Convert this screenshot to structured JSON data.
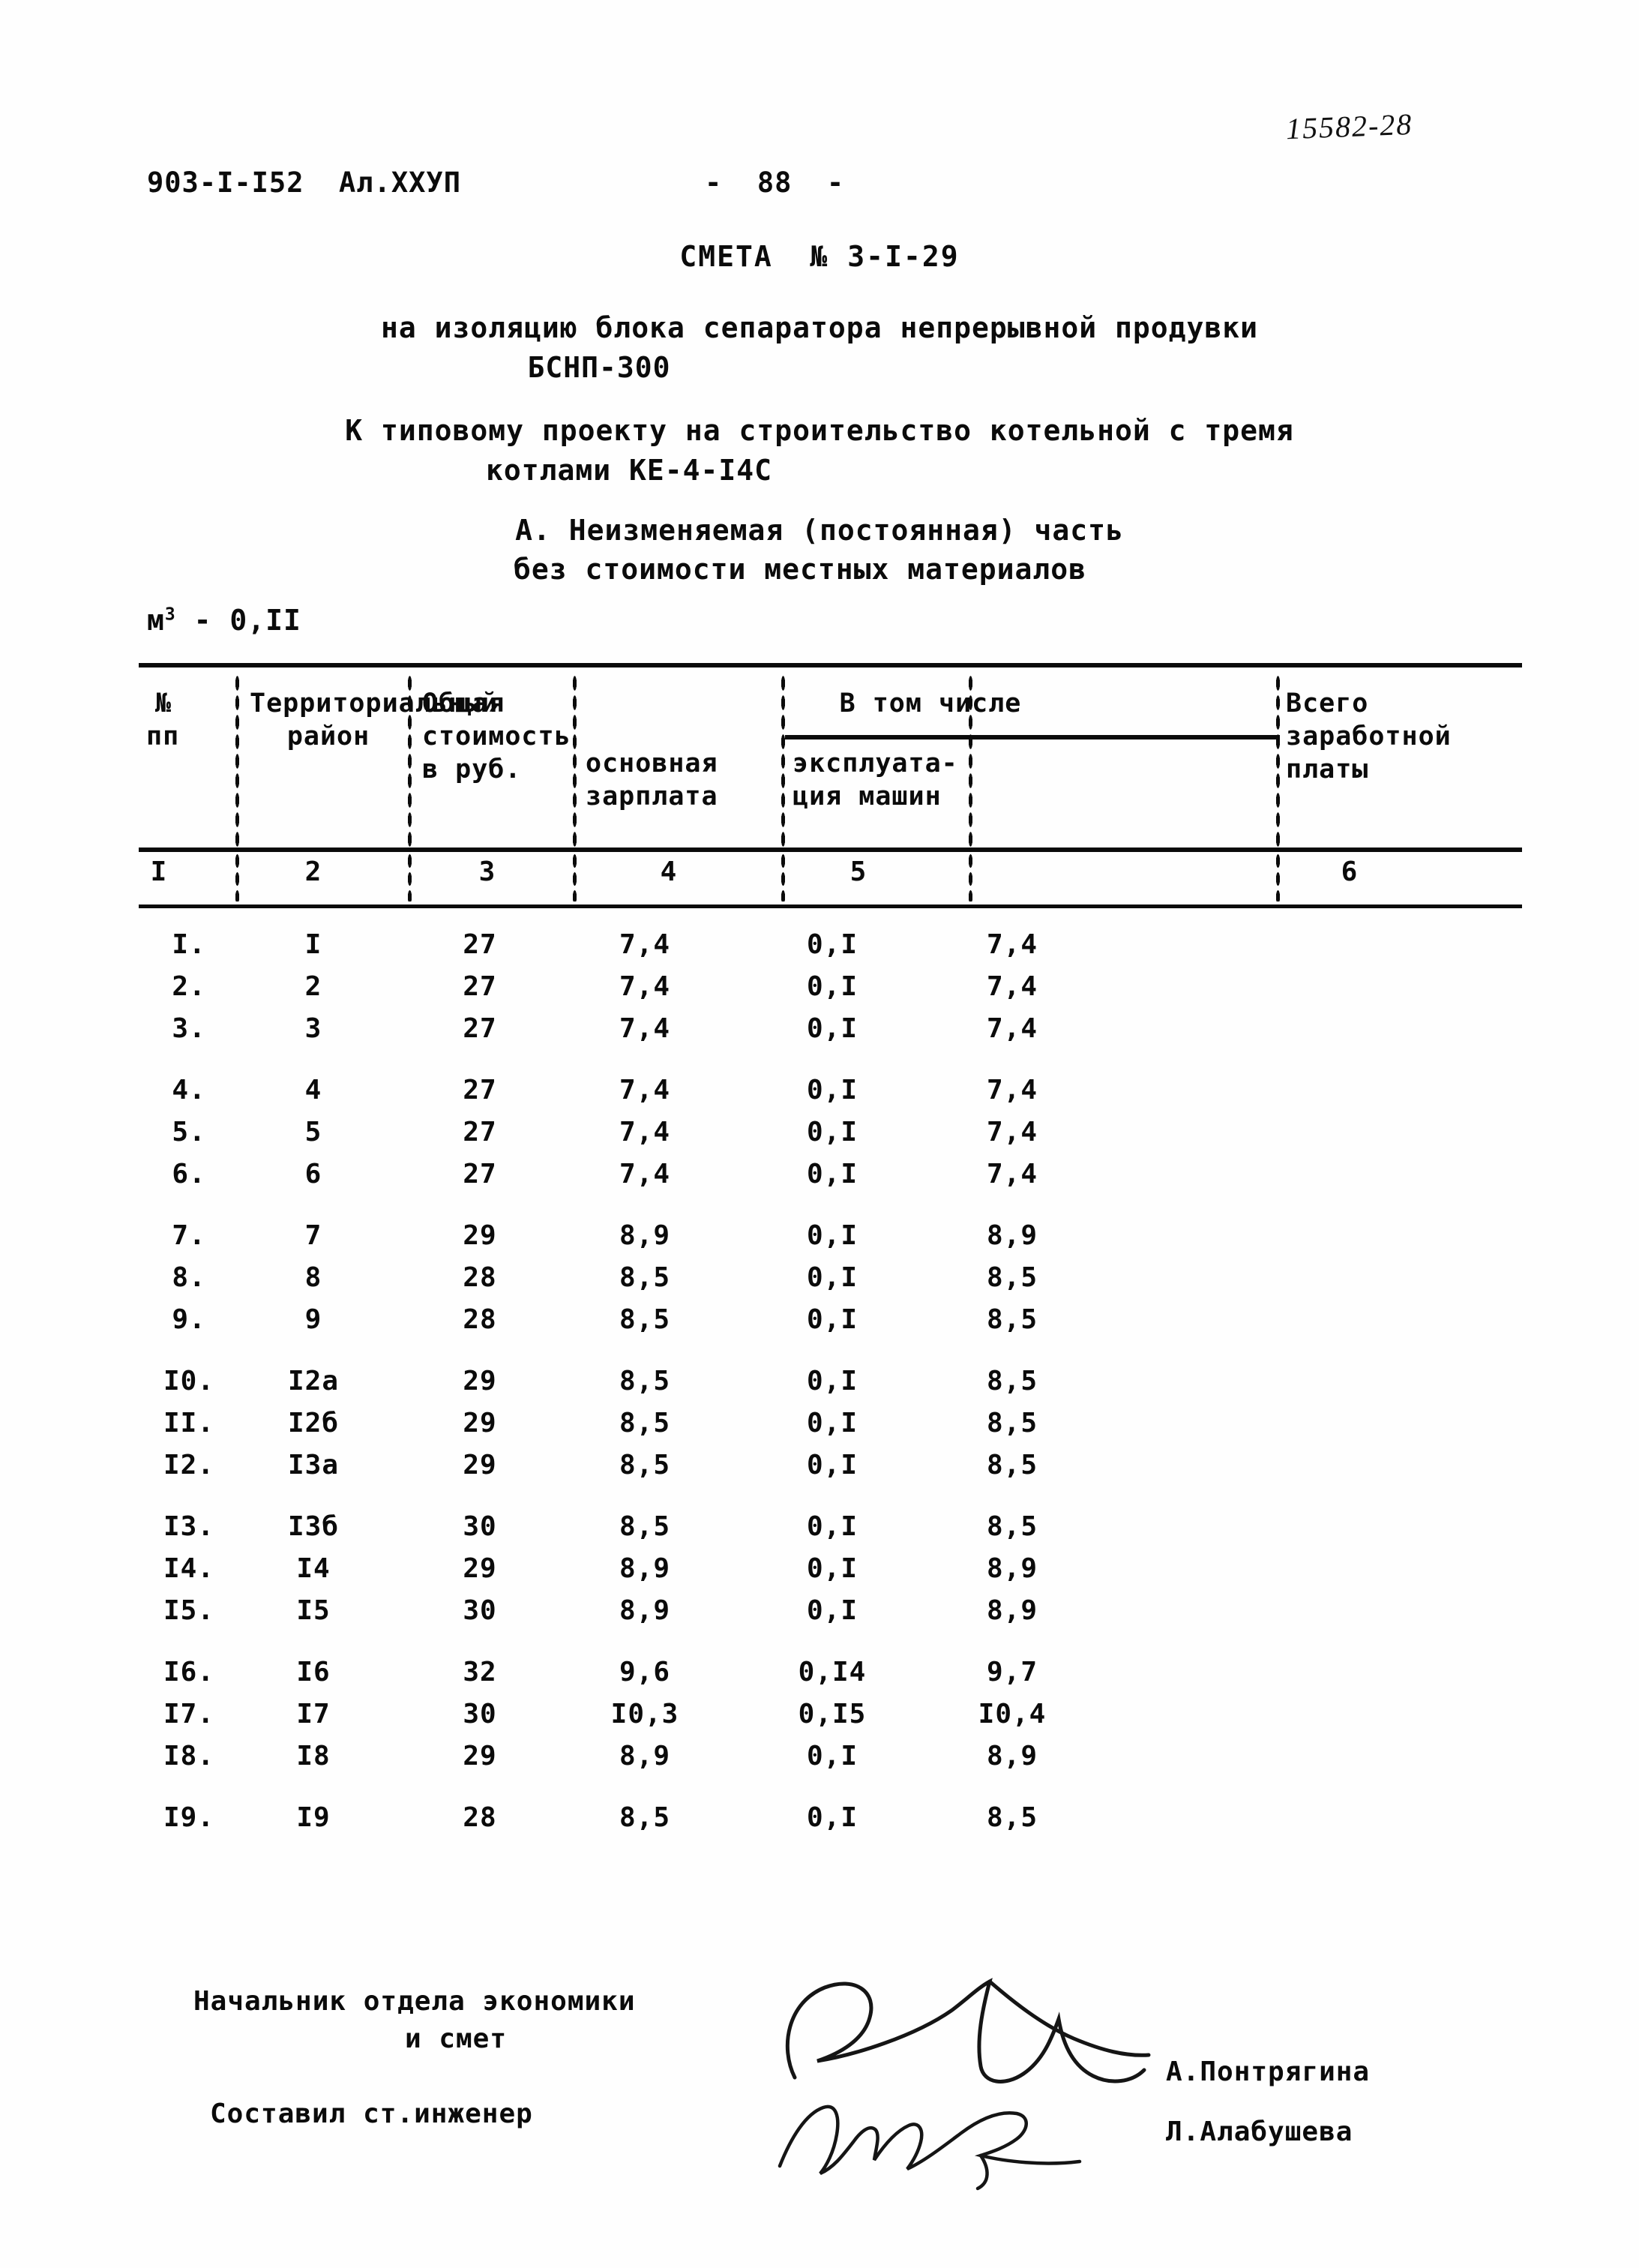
{
  "header": {
    "stamp_number": "15582-28",
    "doc_code": "903-I-I52  Ал.XXУП",
    "page_number": "-  88  -"
  },
  "title": {
    "estimate": "СМЕТА  № 3-I-29",
    "subject_line_1": "на изоляцию блока сепаратора непрерывной продувки",
    "subject_line_2": "БСНП-300",
    "project_line_1": "К типовому проекту на строительство котельной с тремя",
    "project_line_2": "котлами КЕ-4-I4С",
    "part_line_1": "А. Неизменяемая (постоянная) часть",
    "part_line_2": "без стоимости местных материалов",
    "unit_prefix": "м",
    "unit_sup": "3",
    "unit_value": " - 0,II"
  },
  "table": {
    "headers": {
      "no_line1": "№",
      "no_line2": "пп",
      "region_line1": "Территориальный",
      "region_line2": "район",
      "total_line1": "Общая",
      "total_line2": "стоимость",
      "total_line3": "в руб.",
      "among_which": "В том числе",
      "base_line1": "основная",
      "base_line2": "зарплата",
      "mach_line1": "эксплуата-",
      "mach_line2": "ция машин",
      "all_line1": "Всего",
      "all_line2": "заработной",
      "all_line3": "платы"
    },
    "column_numbers": [
      "I",
      "2",
      "3",
      "4",
      "5",
      "6"
    ],
    "rows": [
      {
        "no": "I.",
        "region": "I",
        "total": "27",
        "base": "7,4",
        "machines": "0,I",
        "all": "7,4",
        "group": 1
      },
      {
        "no": "2.",
        "region": "2",
        "total": "27",
        "base": "7,4",
        "machines": "0,I",
        "all": "7,4",
        "group": 1
      },
      {
        "no": "3.",
        "region": "3",
        "total": "27",
        "base": "7,4",
        "machines": "0,I",
        "all": "7,4",
        "group": 1
      },
      {
        "no": "4.",
        "region": "4",
        "total": "27",
        "base": "7,4",
        "machines": "0,I",
        "all": "7,4",
        "group": 2
      },
      {
        "no": "5.",
        "region": "5",
        "total": "27",
        "base": "7,4",
        "machines": "0,I",
        "all": "7,4",
        "group": 2
      },
      {
        "no": "6.",
        "region": "6",
        "total": "27",
        "base": "7,4",
        "machines": "0,I",
        "all": "7,4",
        "group": 2
      },
      {
        "no": "7.",
        "region": "7",
        "total": "29",
        "base": "8,9",
        "machines": "0,I",
        "all": "8,9",
        "group": 3
      },
      {
        "no": "8.",
        "region": "8",
        "total": "28",
        "base": "8,5",
        "machines": "0,I",
        "all": "8,5",
        "group": 3
      },
      {
        "no": "9.",
        "region": "9",
        "total": "28",
        "base": "8,5",
        "machines": "0,I",
        "all": "8,5",
        "group": 3
      },
      {
        "no": "I0.",
        "region": "I2а",
        "total": "29",
        "base": "8,5",
        "machines": "0,I",
        "all": "8,5",
        "group": 4
      },
      {
        "no": "II.",
        "region": "I2б",
        "total": "29",
        "base": "8,5",
        "machines": "0,I",
        "all": "8,5",
        "group": 4
      },
      {
        "no": "I2.",
        "region": "I3а",
        "total": "29",
        "base": "8,5",
        "machines": "0,I",
        "all": "8,5",
        "group": 4
      },
      {
        "no": "I3.",
        "region": "I3б",
        "total": "30",
        "base": "8,5",
        "machines": "0,I",
        "all": "8,5",
        "group": 5
      },
      {
        "no": "I4.",
        "region": "I4",
        "total": "29",
        "base": "8,9",
        "machines": "0,I",
        "all": "8,9",
        "group": 5
      },
      {
        "no": "I5.",
        "region": "I5",
        "total": "30",
        "base": "8,9",
        "machines": "0,I",
        "all": "8,9",
        "group": 5
      },
      {
        "no": "I6.",
        "region": "I6",
        "total": "32",
        "base": "9,6",
        "machines": "0,I4",
        "all": "9,7",
        "group": 6
      },
      {
        "no": "I7.",
        "region": "I7",
        "total": "30",
        "base": "I0,3",
        "machines": "0,I5",
        "all": "I0,4",
        "group": 6
      },
      {
        "no": "I8.",
        "region": "I8",
        "total": "29",
        "base": "8,9",
        "machines": "0,I",
        "all": "8,9",
        "group": 6
      },
      {
        "no": "I9.",
        "region": "I9",
        "total": "28",
        "base": "8,5",
        "machines": "0,I",
        "all": "8,5",
        "group": 7
      }
    ]
  },
  "signatures": {
    "role_1_line1": "Начальник отдела экономики",
    "role_1_line2": "и смет",
    "role_2": "Составил ст.инженер",
    "name_1": "А.Понтрягина",
    "name_2": "Л.Алабушева"
  }
}
